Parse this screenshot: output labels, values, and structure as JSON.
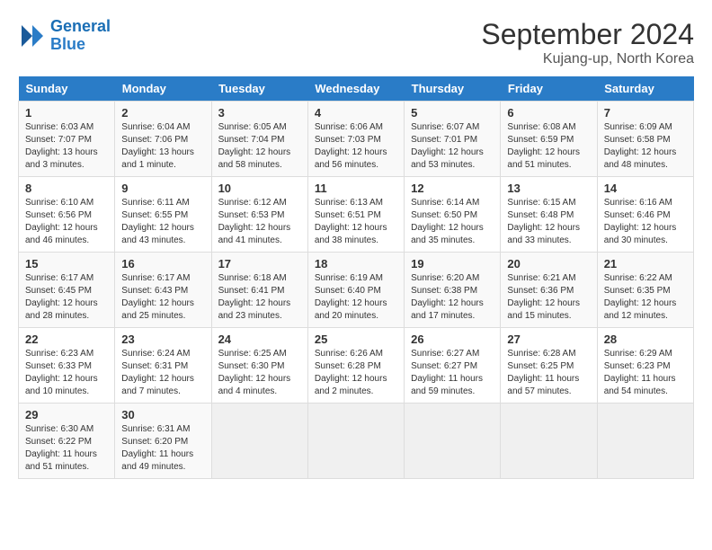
{
  "header": {
    "logo_line1": "General",
    "logo_line2": "Blue",
    "month": "September 2024",
    "location": "Kujang-up, North Korea"
  },
  "days_of_week": [
    "Sunday",
    "Monday",
    "Tuesday",
    "Wednesday",
    "Thursday",
    "Friday",
    "Saturday"
  ],
  "weeks": [
    [
      {
        "day": "1",
        "info": "Sunrise: 6:03 AM\nSunset: 7:07 PM\nDaylight: 13 hours\nand 3 minutes."
      },
      {
        "day": "2",
        "info": "Sunrise: 6:04 AM\nSunset: 7:06 PM\nDaylight: 13 hours\nand 1 minute."
      },
      {
        "day": "3",
        "info": "Sunrise: 6:05 AM\nSunset: 7:04 PM\nDaylight: 12 hours\nand 58 minutes."
      },
      {
        "day": "4",
        "info": "Sunrise: 6:06 AM\nSunset: 7:03 PM\nDaylight: 12 hours\nand 56 minutes."
      },
      {
        "day": "5",
        "info": "Sunrise: 6:07 AM\nSunset: 7:01 PM\nDaylight: 12 hours\nand 53 minutes."
      },
      {
        "day": "6",
        "info": "Sunrise: 6:08 AM\nSunset: 6:59 PM\nDaylight: 12 hours\nand 51 minutes."
      },
      {
        "day": "7",
        "info": "Sunrise: 6:09 AM\nSunset: 6:58 PM\nDaylight: 12 hours\nand 48 minutes."
      }
    ],
    [
      {
        "day": "8",
        "info": "Sunrise: 6:10 AM\nSunset: 6:56 PM\nDaylight: 12 hours\nand 46 minutes."
      },
      {
        "day": "9",
        "info": "Sunrise: 6:11 AM\nSunset: 6:55 PM\nDaylight: 12 hours\nand 43 minutes."
      },
      {
        "day": "10",
        "info": "Sunrise: 6:12 AM\nSunset: 6:53 PM\nDaylight: 12 hours\nand 41 minutes."
      },
      {
        "day": "11",
        "info": "Sunrise: 6:13 AM\nSunset: 6:51 PM\nDaylight: 12 hours\nand 38 minutes."
      },
      {
        "day": "12",
        "info": "Sunrise: 6:14 AM\nSunset: 6:50 PM\nDaylight: 12 hours\nand 35 minutes."
      },
      {
        "day": "13",
        "info": "Sunrise: 6:15 AM\nSunset: 6:48 PM\nDaylight: 12 hours\nand 33 minutes."
      },
      {
        "day": "14",
        "info": "Sunrise: 6:16 AM\nSunset: 6:46 PM\nDaylight: 12 hours\nand 30 minutes."
      }
    ],
    [
      {
        "day": "15",
        "info": "Sunrise: 6:17 AM\nSunset: 6:45 PM\nDaylight: 12 hours\nand 28 minutes."
      },
      {
        "day": "16",
        "info": "Sunrise: 6:17 AM\nSunset: 6:43 PM\nDaylight: 12 hours\nand 25 minutes."
      },
      {
        "day": "17",
        "info": "Sunrise: 6:18 AM\nSunset: 6:41 PM\nDaylight: 12 hours\nand 23 minutes."
      },
      {
        "day": "18",
        "info": "Sunrise: 6:19 AM\nSunset: 6:40 PM\nDaylight: 12 hours\nand 20 minutes."
      },
      {
        "day": "19",
        "info": "Sunrise: 6:20 AM\nSunset: 6:38 PM\nDaylight: 12 hours\nand 17 minutes."
      },
      {
        "day": "20",
        "info": "Sunrise: 6:21 AM\nSunset: 6:36 PM\nDaylight: 12 hours\nand 15 minutes."
      },
      {
        "day": "21",
        "info": "Sunrise: 6:22 AM\nSunset: 6:35 PM\nDaylight: 12 hours\nand 12 minutes."
      }
    ],
    [
      {
        "day": "22",
        "info": "Sunrise: 6:23 AM\nSunset: 6:33 PM\nDaylight: 12 hours\nand 10 minutes."
      },
      {
        "day": "23",
        "info": "Sunrise: 6:24 AM\nSunset: 6:31 PM\nDaylight: 12 hours\nand 7 minutes."
      },
      {
        "day": "24",
        "info": "Sunrise: 6:25 AM\nSunset: 6:30 PM\nDaylight: 12 hours\nand 4 minutes."
      },
      {
        "day": "25",
        "info": "Sunrise: 6:26 AM\nSunset: 6:28 PM\nDaylight: 12 hours\nand 2 minutes."
      },
      {
        "day": "26",
        "info": "Sunrise: 6:27 AM\nSunset: 6:27 PM\nDaylight: 11 hours\nand 59 minutes."
      },
      {
        "day": "27",
        "info": "Sunrise: 6:28 AM\nSunset: 6:25 PM\nDaylight: 11 hours\nand 57 minutes."
      },
      {
        "day": "28",
        "info": "Sunrise: 6:29 AM\nSunset: 6:23 PM\nDaylight: 11 hours\nand 54 minutes."
      }
    ],
    [
      {
        "day": "29",
        "info": "Sunrise: 6:30 AM\nSunset: 6:22 PM\nDaylight: 11 hours\nand 51 minutes."
      },
      {
        "day": "30",
        "info": "Sunrise: 6:31 AM\nSunset: 6:20 PM\nDaylight: 11 hours\nand 49 minutes."
      },
      {
        "day": "",
        "info": ""
      },
      {
        "day": "",
        "info": ""
      },
      {
        "day": "",
        "info": ""
      },
      {
        "day": "",
        "info": ""
      },
      {
        "day": "",
        "info": ""
      }
    ]
  ]
}
